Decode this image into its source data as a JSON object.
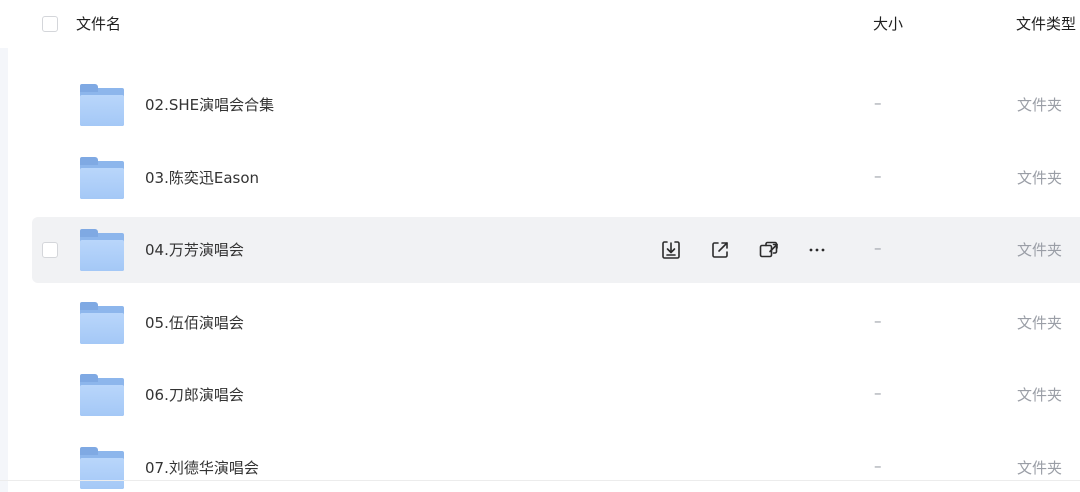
{
  "header": {
    "col_name": "文件名",
    "col_size": "大小",
    "col_type": "文件类型"
  },
  "rows": [
    {
      "name": "",
      "size": "",
      "type": ""
    },
    {
      "name": "02.SHE演唱会合集",
      "size": "–",
      "type": "文件夹"
    },
    {
      "name": "03.陈奕迅Eason",
      "size": "–",
      "type": "文件夹"
    },
    {
      "name": "04.万芳演唱会",
      "size": "–",
      "type": "文件夹",
      "hovered": true
    },
    {
      "name": "05.伍佰演唱会",
      "size": "–",
      "type": "文件夹"
    },
    {
      "name": "06.刀郎演唱会",
      "size": "–",
      "type": "文件夹"
    },
    {
      "name": "07.刘德华演唱会",
      "size": "–",
      "type": "文件夹"
    }
  ],
  "row_actions": {
    "icons": [
      "download-icon",
      "share-icon",
      "copy-link-icon",
      "more-icon"
    ]
  },
  "colors": {
    "folder_light": "#b9d6fb",
    "folder_dark": "#8db6ec",
    "hover_row": "#f1f2f4",
    "muted_text": "#9a9ea6"
  }
}
